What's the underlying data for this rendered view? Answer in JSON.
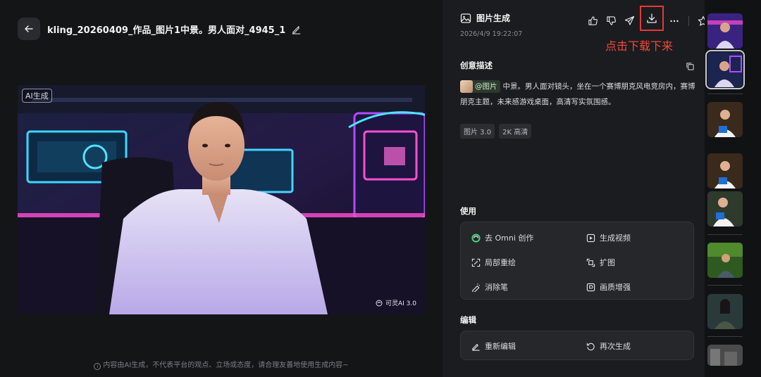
{
  "header": {
    "file_title": "kling_20260409_作品_图片1中景。男人面对_4945_1",
    "back_icon": "arrow-left-icon",
    "edit_icon": "pencil-icon"
  },
  "image": {
    "ai_badge": "AI生成",
    "watermark": "可灵AI 3.0"
  },
  "disclaimer": "内容由AI生成，不代表平台的观点、立场或态度，请合理友善地使用生成内容~",
  "panel": {
    "gen_type": "图片生成",
    "timestamp": "2026/4/9 19:22:07",
    "actions": [
      "thumbs-up-icon",
      "thumbs-down-icon",
      "send-icon",
      "download-icon",
      "more-icon",
      "star-icon"
    ],
    "callout": "点击下载下来",
    "callout_color": "#f04a3a",
    "creative_title": "创意描述",
    "ref_chip": "@图片",
    "prompt": "中景。男人面对镜头，坐在一个赛博朋克风电竞房内，赛博朋克主题，未来感游戏桌面，高清写实氛围感。",
    "tags": [
      "图片 3.0",
      "2K 高清"
    ],
    "use_title": "使用",
    "use_items": {
      "omni": "去 Omni 创作",
      "video": "生成视频",
      "inpaint": "局部重绘",
      "expand": "扩图",
      "eraser": "消除笔",
      "enhance": "画质增强"
    },
    "edit_title": "编辑",
    "edit_items": {
      "reedit": "重新编辑",
      "regen": "再次生成"
    }
  }
}
